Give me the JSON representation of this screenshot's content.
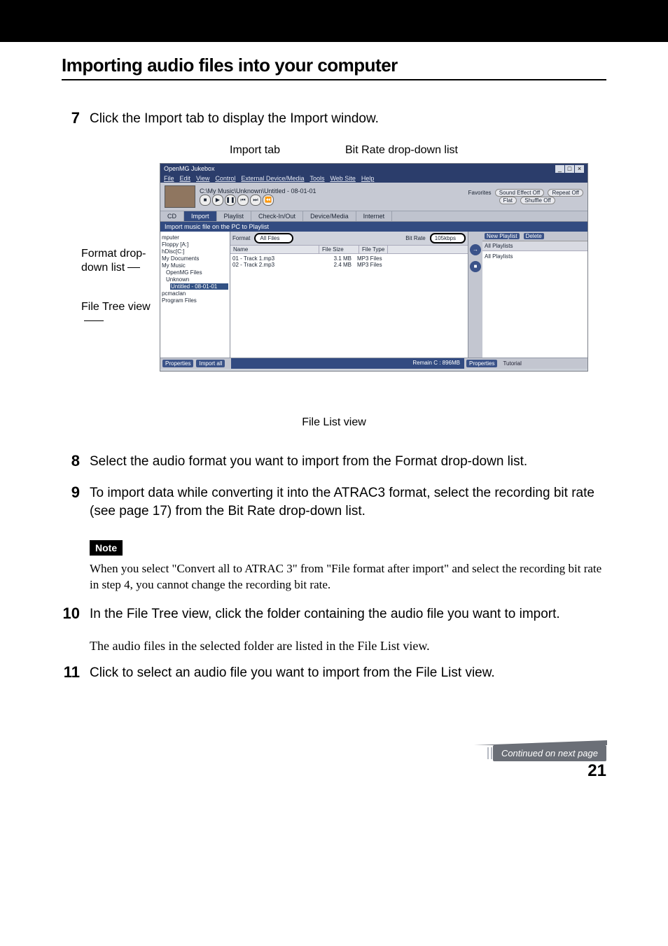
{
  "title": "Importing audio files into your computer",
  "labels": {
    "import_tab": "Import tab",
    "bitrate_dd": "Bit Rate drop-down list",
    "format_dd": "Format drop-down list",
    "filetree": "File Tree view",
    "filelist": "File List view"
  },
  "steps": {
    "n7": "7",
    "t7": "Click the Import tab to display the Import window.",
    "n8": "8",
    "t8": "Select the audio format you want to import from the Format drop-down list.",
    "n9": "9",
    "t9": "To import data while converting it into the ATRAC3 format, select the recording bit rate (see page 17) from the Bit Rate drop-down list.",
    "n10": "10",
    "t10": "In the File Tree view, click the folder containing the audio file you want to import.",
    "t10b": "The audio files in the selected folder are listed in the File List view.",
    "n11": "11",
    "t11": "Click to select an audio file you want to import from the File List view."
  },
  "note": {
    "label": "Note",
    "text": "When you select \"Convert all to ATRAC 3\" from \"File format after import\" and select the recording bit rate in step 4, you cannot change the recording bit rate."
  },
  "ss": {
    "title": "OpenMG Jukebox",
    "menus": [
      "File",
      "Edit",
      "View",
      "Control",
      "External Device/Media",
      "Tools",
      "Web Site",
      "Help"
    ],
    "path": "C:\\My Music\\Unknown\\Untitled - 08-01-01",
    "favorites": "Favorites",
    "sfx": "Sound Effect Off",
    "flat": "Flat",
    "repeat": "Repeat Off",
    "shuffle": "Shuffle Off",
    "tabs": {
      "cd": "CD",
      "import": "Import",
      "playlist": "Playlist",
      "check": "Check-In/Out",
      "device": "Device/Media",
      "internet": "Internet"
    },
    "instruction": "Import music file on the PC to Playlist",
    "format_label": "Format",
    "format_value": "All Files",
    "bitrate_label": "Bit Rate",
    "bitrate_value": "105kbps",
    "cols": {
      "name": "Name",
      "size": "File Size",
      "type": "File Type"
    },
    "rows": [
      {
        "name": "01 - Track 1.mp3",
        "size": "3.1 MB",
        "type": "MP3 Files"
      },
      {
        "name": "02 - Track 2.mp3",
        "size": "2.4 MB",
        "type": "MP3 Files"
      }
    ],
    "tree": [
      "mputer",
      "Floppy [A:]",
      "hDisc[C:]",
      "My Documents",
      "My Music",
      "OpenMG Files",
      "Unknown",
      "Untitled - 08-01-01",
      "pcmaclan",
      "Program Files"
    ],
    "tree_sel": "Untitled - 08-01-01",
    "sidebtn": {
      "import": "Import",
      "stop": "Stop"
    },
    "pl": {
      "new": "New Playlist",
      "del": "Delete",
      "all": "All Playlists",
      "allpl": "All Playlists"
    },
    "footer": {
      "props": "Properties",
      "importall": "Import all",
      "remain": "Remain C : 896MB",
      "props2": "Properties",
      "tutorial": "Tutorial"
    }
  },
  "continued": "Continued on next page",
  "page": "21"
}
